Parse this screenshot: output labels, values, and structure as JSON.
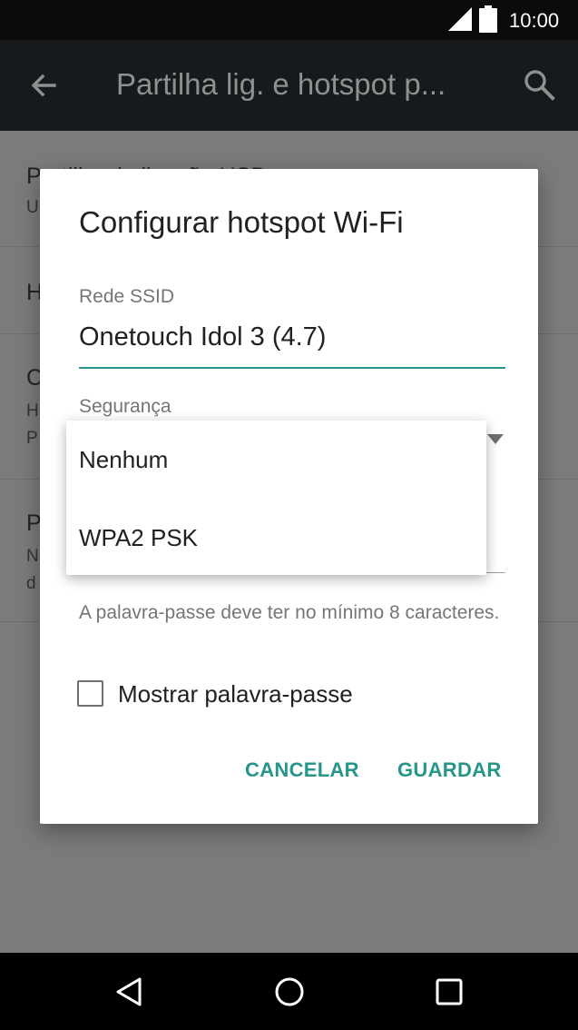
{
  "status_bar": {
    "time": "10:00",
    "icons": [
      "signal-icon",
      "battery-icon"
    ]
  },
  "app_bar": {
    "title": "Partilha lig. e hotspot p...",
    "icons": [
      "back-arrow-icon",
      "search-icon"
    ]
  },
  "background_list": {
    "rows": [
      {
        "title": "Partilha de ligação USB",
        "subtitle": "U"
      },
      {
        "title": "H",
        "subtitle": ""
      },
      {
        "title": "C",
        "subtitle": "H",
        "subtitle2": "P"
      },
      {
        "title": "P",
        "subtitle": "N",
        "subtitle2": "d"
      }
    ]
  },
  "dialog": {
    "title": "Configurar hotspot Wi-Fi",
    "ssid_label": "Rede SSID",
    "ssid_value": "Onetouch Idol 3 (4.7)",
    "security_label": "Segurança",
    "password_hint": "A palavra-passe deve ter no mínimo 8 caracteres.",
    "show_password_label": "Mostrar palavra-passe",
    "show_password_checked": false,
    "cancel_label": "CANCELAR",
    "save_label": "GUARDAR"
  },
  "security_dropdown": {
    "options": [
      "Nenhum",
      "WPA2 PSK"
    ]
  },
  "nav_bar": {
    "icons": [
      "back-triangle-icon",
      "home-circle-icon",
      "recents-square-icon"
    ]
  },
  "colors": {
    "accent": "#26958a",
    "app_bar": "#171a1c",
    "status_bar": "#0b0b0b"
  }
}
